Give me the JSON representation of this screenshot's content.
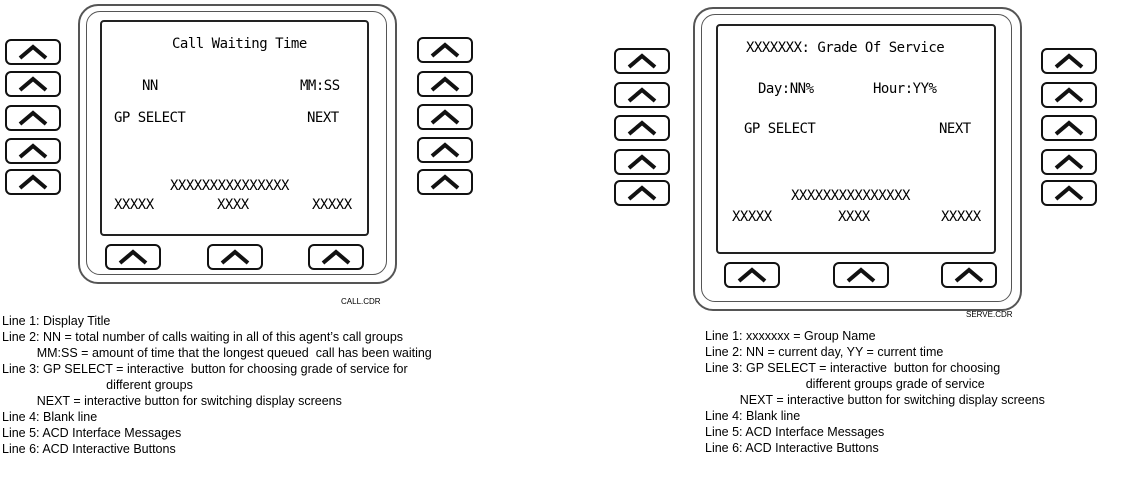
{
  "left_panel": {
    "screen": {
      "title": "Call Waiting Time",
      "line2_left": "NN",
      "line2_right": "MM:SS",
      "line3_left": "GP SELECT",
      "line3_right": "NEXT",
      "line5_message": "XXXXXXXXXXXXXXX",
      "line6_left": "XXXXX",
      "line6_center": "XXXX",
      "line6_right": "XXXXX"
    },
    "file_label": "CALL.CDR",
    "descriptions": [
      "Line 1: Display Title",
      "Line 2: NN = total number of calls waiting in all of this agent’s call groups",
      "          MM:SS = amount of time that the longest queued  call has been waiting",
      "Line 3: GP SELECT = interactive  button for choosing grade of service for",
      "                              different groups",
      "          NEXT = interactive button for switching display screens",
      "Line 4: Blank line",
      "Line 5: ACD Interface Messages",
      "Line 6: ACD Interactive Buttons"
    ]
  },
  "right_panel": {
    "screen": {
      "title": "XXXXXXX: Grade Of Service",
      "line2_left": "Day:NN%",
      "line2_right": "Hour:YY%",
      "line3_left": "GP SELECT",
      "line3_right": "NEXT",
      "line5_message": "XXXXXXXXXXXXXXX",
      "line6_left": "XXXXX",
      "line6_center": "XXXX",
      "line6_right": "XXXXX"
    },
    "file_label": "SERVE.CDR",
    "descriptions": [
      "Line 1: xxxxxxx = Group Name",
      "Line 2: NN = current day, YY = current time",
      "Line 3: GP SELECT = interactive  button for choosing",
      "                             different groups grade of service",
      "          NEXT = interactive button for switching display screens",
      "Line 4: Blank line",
      "Line 5: ACD Interface Messages",
      "Line 6: ACD Interactive Buttons"
    ]
  },
  "icons": {
    "softkey": "up-chevron-icon"
  }
}
